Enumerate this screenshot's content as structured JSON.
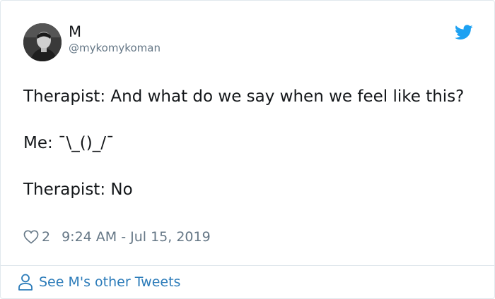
{
  "user": {
    "display_name": "M",
    "handle": "@mykomykoman"
  },
  "icons": {
    "bird": "twitter-bird-icon",
    "heart": "heart-icon",
    "person": "person-icon"
  },
  "colors": {
    "twitter_blue": "#1da1f2",
    "link_blue": "#2b7bb9",
    "text": "#14171a",
    "muted": "#657786",
    "border": "#e1e8ed"
  },
  "tweet": {
    "line1": "Therapist: And what do we say when we feel like this?",
    "line2": "Me: ¯\\_()_/¯",
    "line3": "Therapist: No"
  },
  "meta": {
    "like_count": "2",
    "timestamp": "9:24 AM - Jul 15, 2019"
  },
  "footer": {
    "see_more_label": "See M's other Tweets"
  }
}
